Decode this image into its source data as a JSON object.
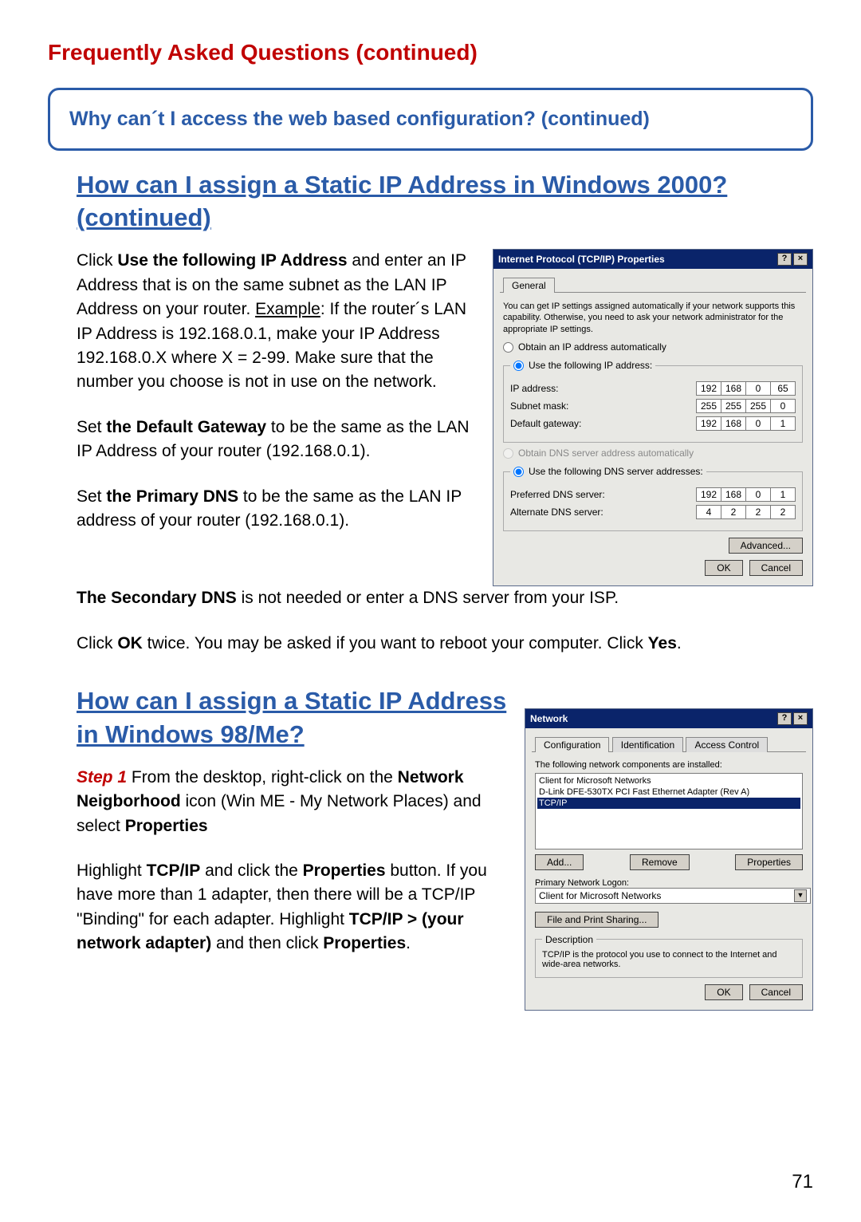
{
  "page_number": "71",
  "faq_title": "Frequently Asked Questions (continued)",
  "callout": "Why can´t I access the web based configuration? (continued)",
  "section1_title": "How can I assign a Static IP Address in Windows 2000? (continued)",
  "section2_title": "How can I assign a Static IP Address in Windows 98/Me?",
  "para": {
    "p1a": "Click ",
    "p1b": "Use the following IP Address",
    "p1c": " and enter an IP Address that is on the same subnet as the LAN IP Address on your router. ",
    "p1d": "Example",
    "p1e": ": If the router´s LAN IP Address is 192.168.0.1, make your IP Address 192.168.0.X where X = 2-99. Make sure that the number you choose is not in use on the network.",
    "p2a": "Set ",
    "p2b": "the Default Gateway",
    "p2c": " to be the same as the LAN IP Address of your router (192.168.0.1).",
    "p3a": "Set ",
    "p3b": "the Primary DNS",
    "p3c": " to be the same as the LAN IP address of your router (192.168.0.1).",
    "p4a": "The Secondary DNS",
    "p4b": " is not needed or enter a DNS server from your ISP.",
    "p5a": "Click ",
    "p5b": "OK",
    "p5c": " twice. You may be asked if you want to reboot your computer. Click ",
    "p5d": "Yes",
    "p5e": ".",
    "p6a": "Step 1",
    "p6b": " From the desktop, right-click on the ",
    "p6c": "Network Neigborhood",
    "p6d": " icon (Win ME - My Network Places) and select ",
    "p6e": "Properties",
    "p7a": "Highlight ",
    "p7b": "TCP/IP",
    "p7c": " and click the ",
    "p7d": "Properties",
    "p7e": " button. If you have more than 1 adapter, then there will be a TCP/IP \"Binding\" for each adapter. Highlight ",
    "p7f": "TCP/IP > (your network adapter)",
    "p7g": " and then click ",
    "p7h": "Properties",
    "p7i": "."
  },
  "dlg1": {
    "title": "Internet Protocol (TCP/IP) Properties",
    "help": "?",
    "close": "×",
    "tab_general": "General",
    "intro": "You can get IP settings assigned automatically if your network supports this capability. Otherwise, you need to ask your network administrator for the appropriate IP settings.",
    "r_auto_ip": "Obtain an IP address automatically",
    "r_use_ip": "Use the following IP address:",
    "lbl_ip": "IP address:",
    "lbl_mask": "Subnet mask:",
    "lbl_gw": "Default gateway:",
    "ip": [
      "192",
      "168",
      "0",
      "65"
    ],
    "mask": [
      "255",
      "255",
      "255",
      "0"
    ],
    "gw": [
      "192",
      "168",
      "0",
      "1"
    ],
    "r_auto_dns": "Obtain DNS server address automatically",
    "r_use_dns": "Use the following DNS server addresses:",
    "lbl_pdns": "Preferred DNS server:",
    "lbl_adns": "Alternate DNS server:",
    "pdns": [
      "192",
      "168",
      "0",
      "1"
    ],
    "adns": [
      "4",
      "2",
      "2",
      "2"
    ],
    "btn_adv": "Advanced...",
    "btn_ok": "OK",
    "btn_cancel": "Cancel"
  },
  "dlg2": {
    "title": "Network",
    "help": "?",
    "close": "×",
    "tab_cfg": "Configuration",
    "tab_id": "Identification",
    "tab_acc": "Access Control",
    "lbl_components": "The following network components are installed:",
    "item1": "Client for Microsoft Networks",
    "item2": "D-Link DFE-530TX PCI Fast Ethernet Adapter (Rev A)",
    "item3": "TCP/IP",
    "btn_add": "Add...",
    "btn_remove": "Remove",
    "btn_props": "Properties",
    "lbl_plogon": "Primary Network Logon:",
    "sel_plogon": "Client for Microsoft Networks",
    "btn_fps": "File and Print Sharing...",
    "desc_legend": "Description",
    "desc_text": "TCP/IP is the protocol you use to connect to the Internet and wide-area networks.",
    "btn_ok": "OK",
    "btn_cancel": "Cancel"
  }
}
